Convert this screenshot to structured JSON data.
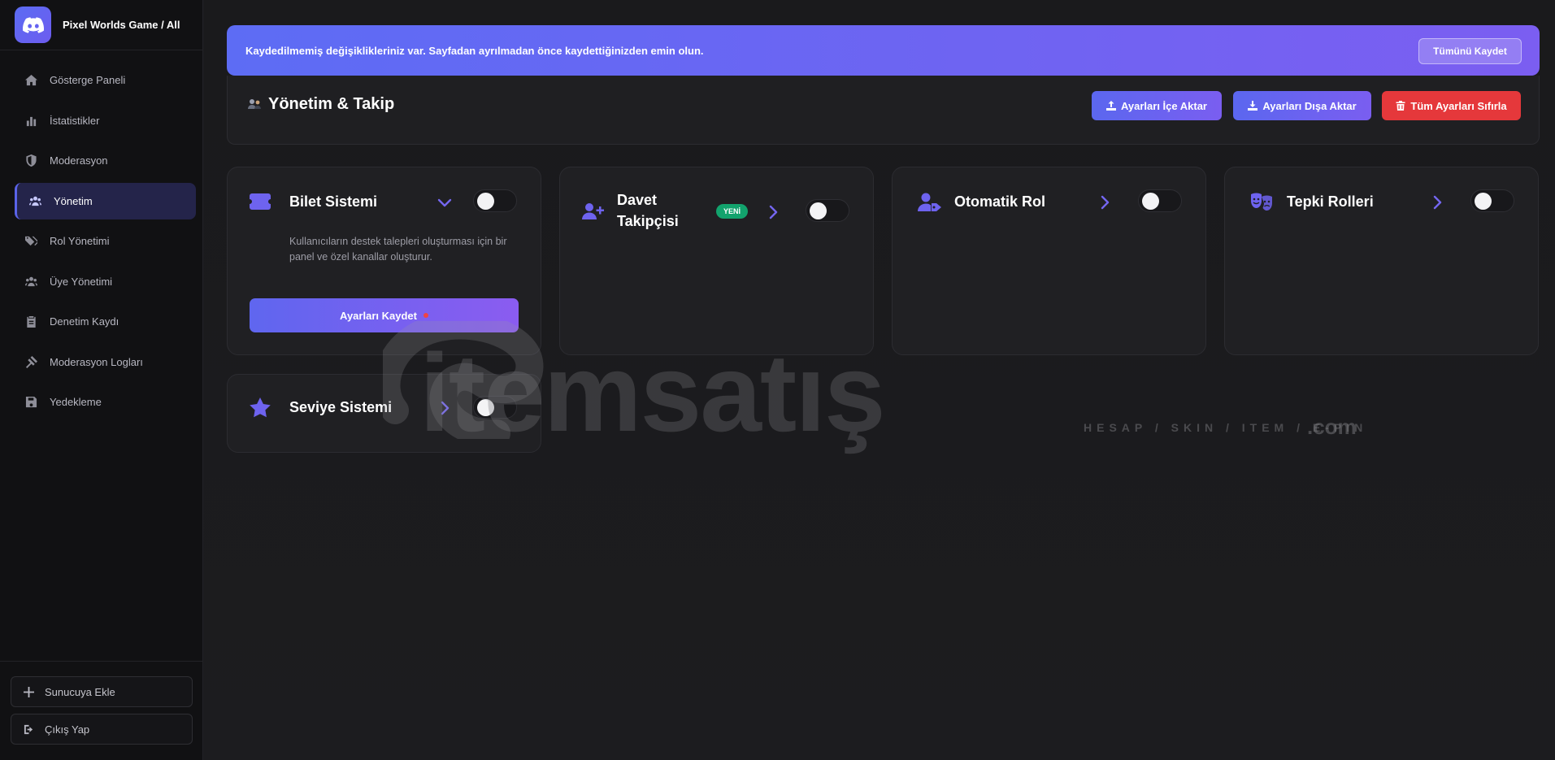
{
  "brand": {
    "title": "Pixel Worlds Game / All",
    "icon": "discord-icon"
  },
  "sidebar": {
    "items": [
      {
        "label": "Gösterge Paneli",
        "icon": "home-icon",
        "active": false
      },
      {
        "label": "İstatistikler",
        "icon": "bar-chart-icon",
        "active": false
      },
      {
        "label": "Moderasyon",
        "icon": "shield-icon",
        "active": false
      },
      {
        "label": "Yönetim",
        "icon": "users-icon",
        "active": true
      },
      {
        "label": "Rol Yönetimi",
        "icon": "tags-icon",
        "active": false
      },
      {
        "label": "Üye Yönetimi",
        "icon": "users-icon",
        "active": false
      },
      {
        "label": "Denetim Kaydı",
        "icon": "clipboard-icon",
        "active": false
      },
      {
        "label": "Moderasyon Logları",
        "icon": "gavel-icon",
        "active": false
      },
      {
        "label": "Yedekleme",
        "icon": "save-icon",
        "active": false
      }
    ],
    "add_server": "Sunucuya Ekle",
    "logout": "Çıkış Yap"
  },
  "banner": {
    "text": "Kaydedilmemiş değişiklikleriniz var. Sayfadan ayrılmadan önce kaydettiğinizden emin olun.",
    "save_all": "Tümünü Kaydet"
  },
  "header": {
    "title": "Yönetim & Takip",
    "import": "Ayarları İçe Aktar",
    "export": "Ayarları Dışa Aktar",
    "reset": "Tüm Ayarları Sıfırla"
  },
  "cards": {
    "ticket": {
      "title": "Bilet Sistemi",
      "description": "Kullanıcıların destek talepleri oluşturması için bir panel ve özel kanallar oluşturur.",
      "save": "Ayarları Kaydet",
      "expanded": true,
      "enabled": false
    },
    "invite": {
      "title": "Davet Takipçisi",
      "badge": "YENİ",
      "enabled": false
    },
    "autorole": {
      "title": "Otomatik Rol",
      "enabled": false
    },
    "reaction": {
      "title": "Tepki Rolleri",
      "enabled": false
    },
    "level": {
      "title": "Seviye Sistemi",
      "enabled": false
    }
  },
  "watermark": {
    "name": "itemsatış",
    "tagline": "HESAP / SKIN / ITEM / E-PIN",
    "tld": ".com"
  },
  "colors": {
    "accent": "#6e63ef",
    "danger": "#e5383b",
    "success": "#12a36d"
  }
}
